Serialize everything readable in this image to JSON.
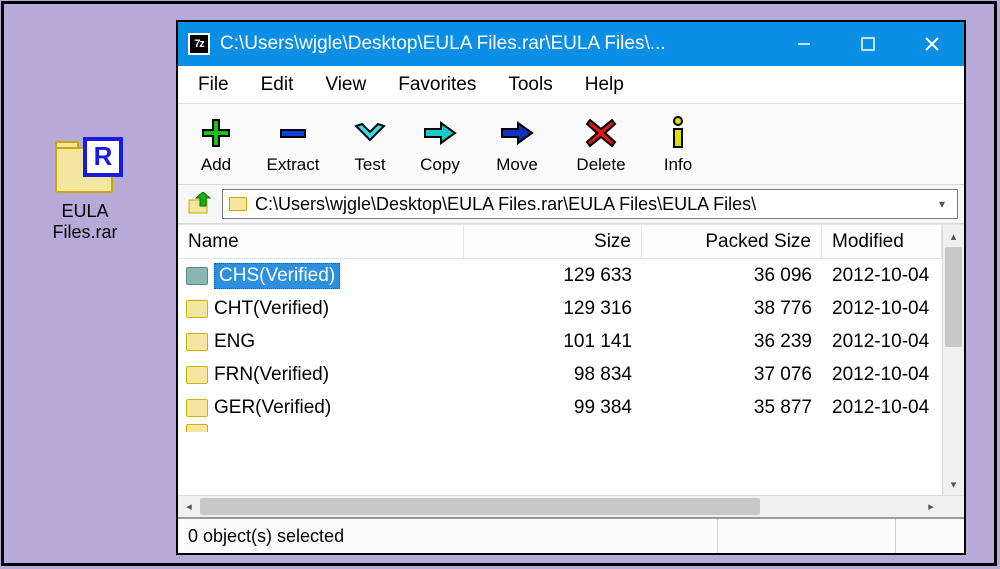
{
  "desktop": {
    "icon_label": "EULA Files.rar",
    "badge_letter": "R"
  },
  "window": {
    "icon_text": "7z",
    "title": "C:\\Users\\wjgle\\Desktop\\EULA Files.rar\\EULA Files\\..."
  },
  "menu": {
    "file": "File",
    "edit": "Edit",
    "view": "View",
    "favorites": "Favorites",
    "tools": "Tools",
    "help": "Help"
  },
  "toolbar": {
    "add": "Add",
    "extract": "Extract",
    "test": "Test",
    "copy": "Copy",
    "move": "Move",
    "delete": "Delete",
    "info": "Info"
  },
  "path": "C:\\Users\\wjgle\\Desktop\\EULA Files.rar\\EULA Files\\EULA Files\\",
  "columns": {
    "name": "Name",
    "size": "Size",
    "packed": "Packed Size",
    "modified": "Modified"
  },
  "rows": [
    {
      "name": "CHS(Verified)",
      "size": "129 633",
      "packed": "36 096",
      "modified": "2012-10-04",
      "selected": true
    },
    {
      "name": "CHT(Verified)",
      "size": "129 316",
      "packed": "38 776",
      "modified": "2012-10-04",
      "selected": false
    },
    {
      "name": "ENG",
      "size": "101 141",
      "packed": "36 239",
      "modified": "2012-10-04",
      "selected": false
    },
    {
      "name": "FRN(Verified)",
      "size": "98 834",
      "packed": "37 076",
      "modified": "2012-10-04",
      "selected": false
    },
    {
      "name": "GER(Verified)",
      "size": "99 384",
      "packed": "35 877",
      "modified": "2012-10-04",
      "selected": false
    }
  ],
  "status": {
    "text": "0 object(s) selected"
  }
}
